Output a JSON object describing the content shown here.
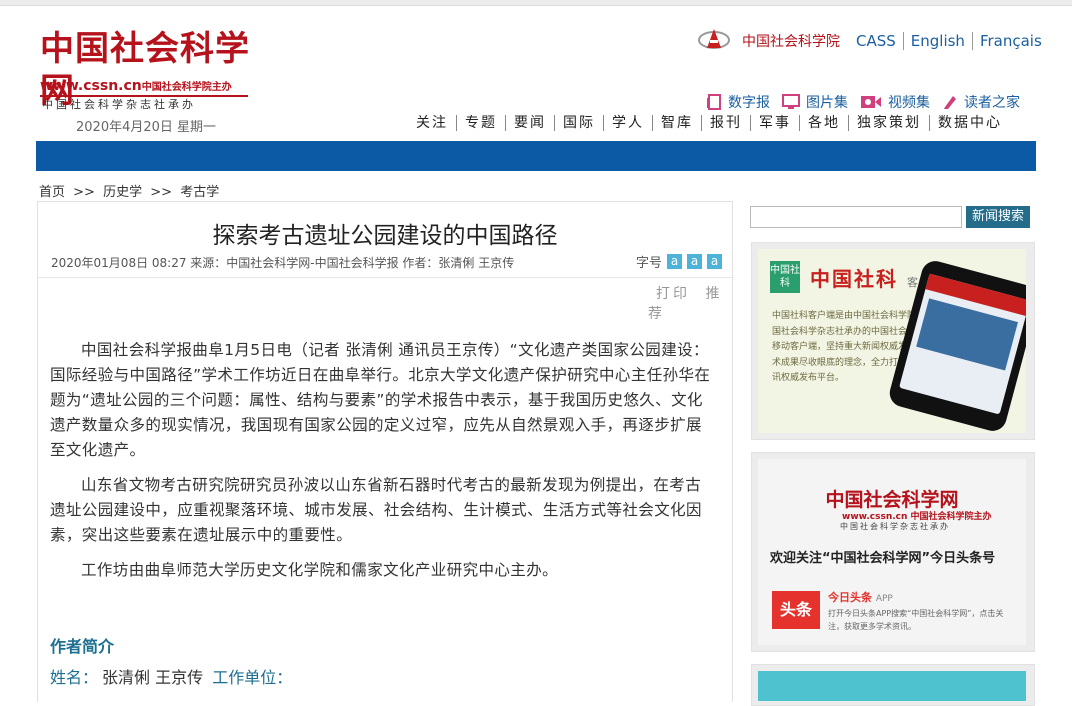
{
  "site": {
    "logo_title": "中国社会科学网",
    "logo_url": "www.cssn.cn",
    "logo_url_suffix": "中国社会科学院主办",
    "logo_sub": "中国社会科学杂志社承办",
    "date": "2020年4月20日  星期一"
  },
  "top_links": {
    "cass_cn": "中国社会科学院",
    "langs": [
      "CASS",
      "English",
      "Français"
    ]
  },
  "feature_links": [
    {
      "label": "数字报",
      "icon": "newspaper-icon"
    },
    {
      "label": "图片集",
      "icon": "monitor-icon"
    },
    {
      "label": "视频集",
      "icon": "video-icon"
    },
    {
      "label": "读者之家",
      "icon": "pen-icon"
    }
  ],
  "nav": [
    "关注",
    "专题",
    "要闻",
    "国际",
    "学人",
    "智库",
    "报刊",
    "军事",
    "各地",
    "独家策划",
    "数据中心"
  ],
  "breadcrumb": [
    "首页",
    ">>",
    "历史学",
    ">>",
    "考古学"
  ],
  "article": {
    "title": "探索考古遗址公园建设的中国路径",
    "meta": "2020年01月08日  08:27  来源：中国社会科学网-中国社会科学报  作者：张清俐  王京传",
    "fontsize_label": "字号",
    "fontsize_buttons": [
      "a",
      "a",
      "a"
    ],
    "print_label": "打印",
    "recommend_label": "推荐",
    "paragraphs": [
      "中国社会科学报曲阜1月5日电（记者 张清俐 通讯员王京传）“文化遗产类国家公园建设：国际经验与中国路径”学术工作坊近日在曲阜举行。北京大学文化遗产保护研究中心主任孙华在题为“遗址公园的三个问题：属性、结构与要素”的学术报告中表示，基于我国历史悠久、文化遗产数量众多的现实情况，我国现有国家公园的定义过窄，应先从自然景观入手，再逐步扩展至文化遗产。",
      "山东省文物考古研究院研究员孙波以山东省新石器时代考古的最新发现为例提出，在考古遗址公园建设中，应重视聚落环境、城市发展、社会结构、生计模式、生活方式等社会文化因素，突出这些要素在遗址展示中的重要性。",
      "工作坊由曲阜师范大学历史文化学院和儒家文化产业研究中心主办。"
    ],
    "author_heading": "作者简介",
    "author_name_label": "姓名：",
    "author_names": "张清俐  王京传",
    "author_unit_label": "工作单位："
  },
  "sidebar": {
    "search_button": "新闻搜索",
    "app_promo": {
      "logo": "中国社科",
      "name": "中国社科",
      "suffix": "客户端",
      "text": "中国社科客户端是由中国社会科学院主办，中国社会科学杂志社承办的中国社会科学网官方移动客户端，坚持重大新闻权威发布，前沿学术成果尽收眼底的理念，全力打造全球学术资讯权威发布平台。"
    },
    "toutiao_promo": {
      "title": "中国社会科学网",
      "url": "www.cssn.cn 中国社会科学院主办",
      "sub": "中国社会科学杂志社承办",
      "follow": "欢迎关注“中国社会科学网”今日头条号",
      "icon_text": "头条",
      "app_name": "今日头条",
      "app_suffix": "APP",
      "desc": "打开今日头条APP搜索“中国社会科学网”，点击关注，获取更多学术资讯。"
    }
  },
  "colors": {
    "brand_red": "#b5121b",
    "nav_blue": "#0c5aa6",
    "link_blue": "#1b5fa0",
    "author_teal": "#1d6f91"
  }
}
